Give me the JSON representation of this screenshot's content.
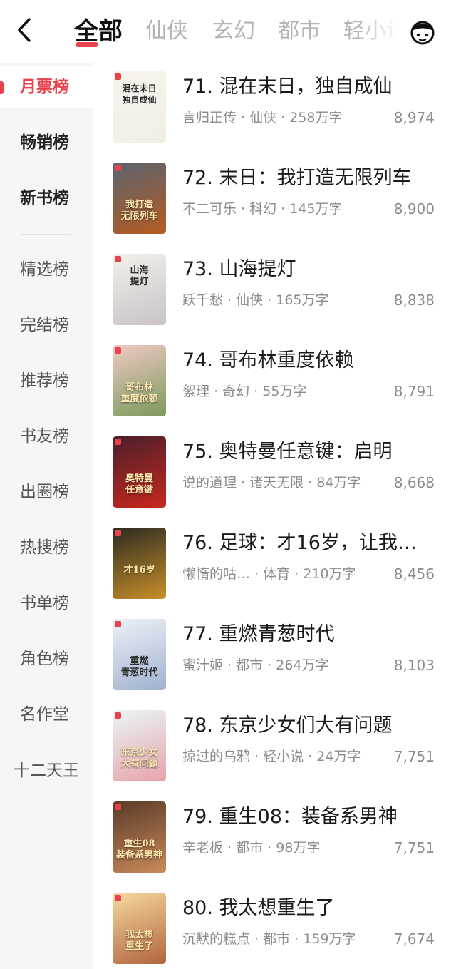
{
  "header": {
    "back_icon": "chevron-left-icon",
    "tabs": [
      "全部",
      "仙侠",
      "玄幻",
      "都市",
      "轻小说"
    ],
    "active_tab": 0,
    "avatar_icon": "reader-avatar-icon"
  },
  "sidebar": {
    "items": [
      "月票榜",
      "畅销榜",
      "新书榜",
      "精选榜",
      "完结榜",
      "推荐榜",
      "书友榜",
      "出圈榜",
      "热搜榜",
      "书单榜",
      "角色榜",
      "名作堂",
      "十二天王"
    ],
    "active_index": 0
  },
  "books": [
    {
      "title": "71. 混在末日，独自成仙",
      "meta": "言归正传 · 仙侠 · 258万字",
      "count": "8,974",
      "cover_text": "混在末日\n独自成仙",
      "cover_colors": [
        "#f7f4ee",
        "#f2eee6"
      ]
    },
    {
      "title": "72. 末日：我打造无限列车",
      "meta": "不二可乐 · 科幻 · 145万字",
      "count": "8,900",
      "cover_text": "我打造\n无限列车",
      "cover_colors": [
        "#5b6470",
        "#b55a22"
      ]
    },
    {
      "title": "73. 山海提灯",
      "meta": "跃千愁 · 仙侠 · 165万字",
      "count": "8,838",
      "cover_text": "山海\n提灯",
      "cover_colors": [
        "#f3f0ea",
        "#c9c3c6"
      ]
    },
    {
      "title": "74. 哥布林重度依赖",
      "meta": "絮理 · 奇幻 · 55万字",
      "count": "8,791",
      "cover_text": "哥布林\n重度依赖",
      "cover_colors": [
        "#f0c9c4",
        "#7b9a5c"
      ]
    },
    {
      "title": "75. 奥特曼任意键：启明",
      "meta": "说的道理 · 诸天无限 · 84万字",
      "count": "8,668",
      "cover_text": "奥特曼\n任意键",
      "cover_colors": [
        "#4a1f2a",
        "#c8281e"
      ]
    },
    {
      "title": "76. 足球：才16岁，让我…",
      "meta": "懒惰的咕…   · 体育 · 210万字",
      "count": "8,456",
      "cover_text": "才16岁",
      "cover_colors": [
        "#2b2a20",
        "#c98f2a"
      ]
    },
    {
      "title": "77. 重燃青葱时代",
      "meta": "蜜汁姬 · 都市 · 264万字",
      "count": "8,103",
      "cover_text": "重燃\n青葱时代",
      "cover_colors": [
        "#eef1f7",
        "#9fb2d0"
      ]
    },
    {
      "title": "78. 东京少女们大有问题",
      "meta": "掠过的乌鸦 · 轻小说 · 24万字",
      "count": "7,751",
      "cover_text": "东京少女\n大有问题",
      "cover_colors": [
        "#eaf6f8",
        "#e7a3a8"
      ]
    },
    {
      "title": "79. 重生08：装备系男神",
      "meta": "辛老板 · 都市 · 98万字",
      "count": "7,751",
      "cover_text": "重生08\n装备系男神",
      "cover_colors": [
        "#5a3a28",
        "#c98a5a"
      ]
    },
    {
      "title": "80. 我太想重生了",
      "meta": "沉默的糕点 · 都市 · 159万字",
      "count": "7,674",
      "cover_text": "我太想\n重生了",
      "cover_colors": [
        "#f6d9a0",
        "#b2643e"
      ]
    }
  ],
  "colors": {
    "accent": "#e8424d",
    "muted": "#8c8c8c",
    "sidebar_bg": "#f6f6f6"
  }
}
